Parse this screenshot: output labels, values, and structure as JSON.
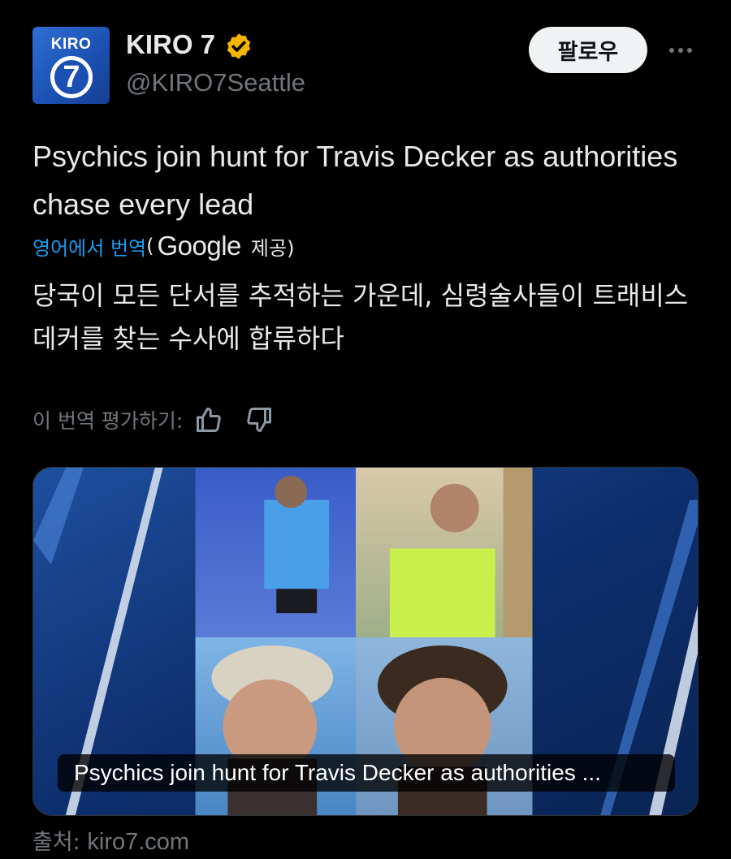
{
  "account": {
    "avatar_text": "KIRO",
    "avatar_number": "7",
    "name": "KIRO 7",
    "handle": "@KIRO7Seattle",
    "verified_icon": "verified-badge-gold"
  },
  "actions": {
    "follow_label": "팔로우",
    "more_icon": "more-horizontal-icon"
  },
  "post": {
    "text": "Psychics join hunt for Travis Decker as authorities chase every lead"
  },
  "translation": {
    "link_label": "영어에서 번역",
    "open_paren": "(",
    "provider": "Google",
    "provided_suffix": "제공)",
    "text": "당국이 모든 단서를 추적하는 가운데, 심령술사들이 트래비스 데커를 찾는 수사에 합류하다",
    "rate_label": "이 번역 평가하기:",
    "thumbs_up_icon": "thumbs-up-icon",
    "thumbs_down_icon": "thumbs-down-icon"
  },
  "card": {
    "caption": "Psychics join hunt for Travis Decker as authorities ..."
  },
  "source": {
    "label": "출처:",
    "domain": "kiro7.com"
  },
  "colors": {
    "background": "#000000",
    "link": "#1d9bf0",
    "muted": "#71767b",
    "verified": "#f4b400",
    "card_blue": "#0b2a5c"
  }
}
